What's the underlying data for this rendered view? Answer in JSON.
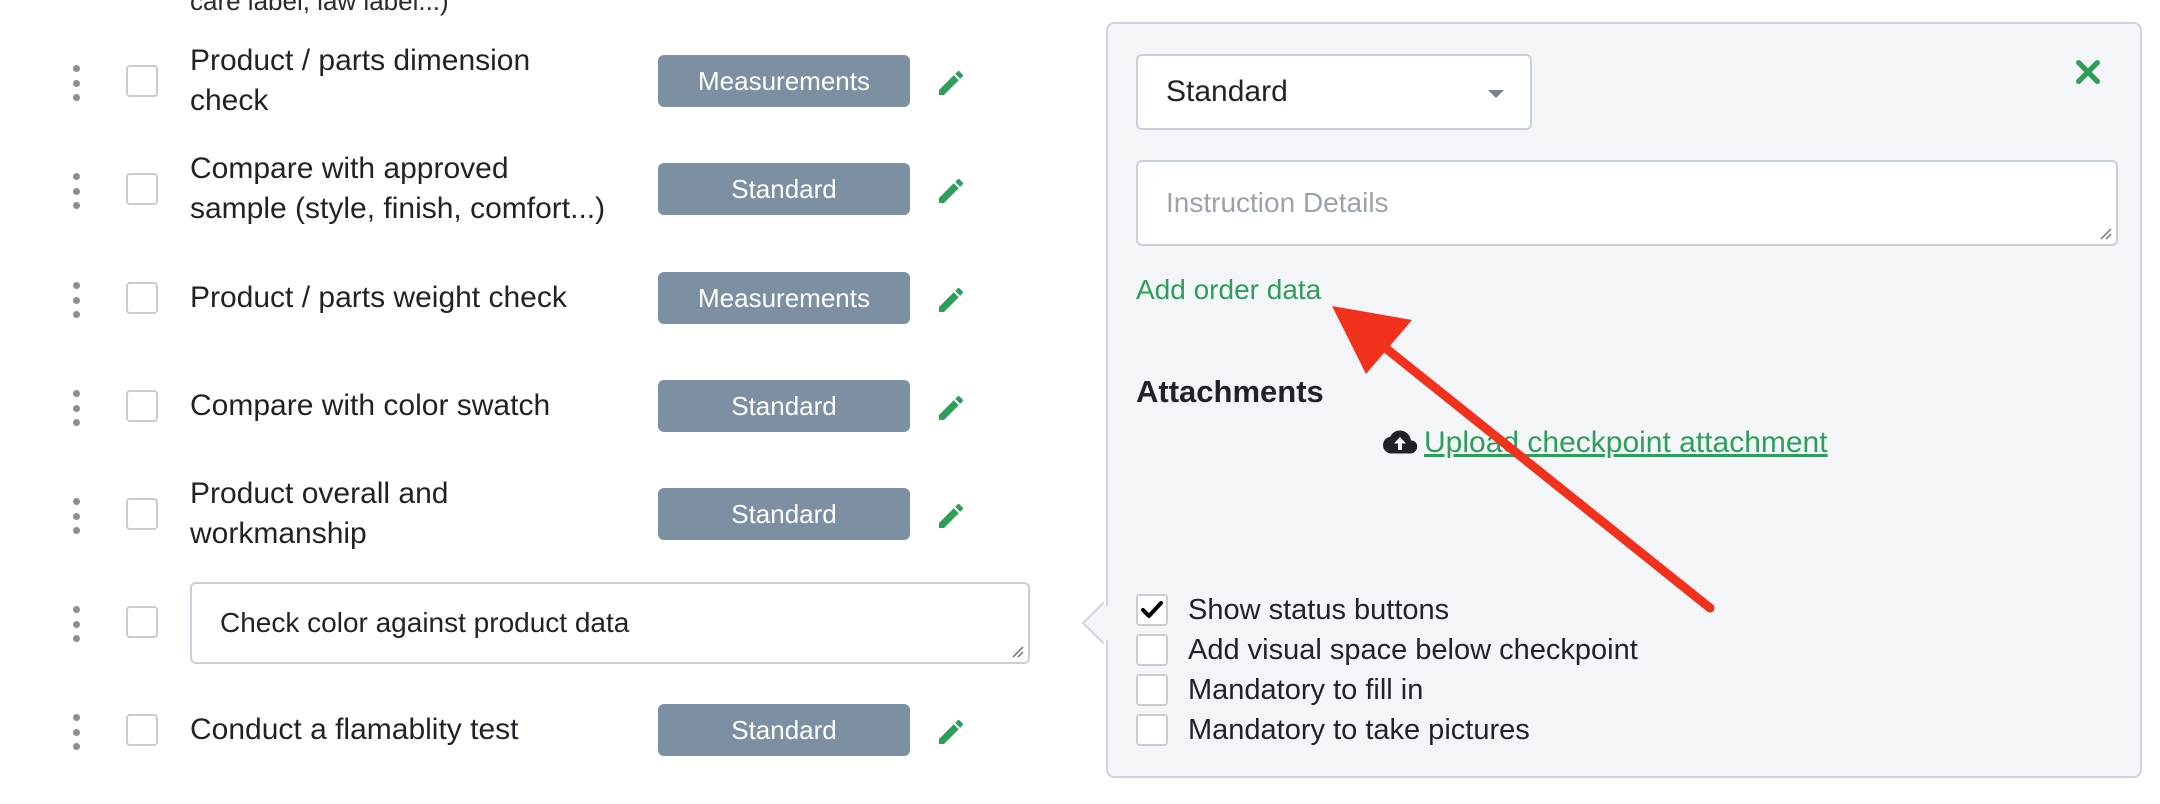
{
  "checklist": {
    "clipped_top_text": "care label, law label...)",
    "items": [
      {
        "label": "Product / parts dimension check",
        "badge": "Measurements"
      },
      {
        "label": "Compare with approved sample (style, finish, comfort...)",
        "badge": "Standard"
      },
      {
        "label": "Product / parts weight check",
        "badge": "Measurements"
      },
      {
        "label": "Compare with color swatch",
        "badge": "Standard"
      },
      {
        "label": "Product overall and workmanship",
        "badge": "Standard"
      }
    ],
    "editing_item": {
      "value": "Check color against product data"
    },
    "last_item": {
      "label": "Conduct a flamablity test",
      "badge": "Standard"
    }
  },
  "panel": {
    "type_select": {
      "value": "Standard"
    },
    "instruction": {
      "placeholder": "Instruction Details"
    },
    "add_order_link": "Add order data",
    "attachments_title": "Attachments",
    "upload_link": "Upload checkpoint attachment",
    "options": [
      {
        "label": "Show status buttons",
        "checked": true
      },
      {
        "label": "Add visual space below checkpoint",
        "checked": false
      },
      {
        "label": "Mandatory to fill in",
        "checked": false
      },
      {
        "label": "Mandatory to take pictures",
        "checked": false
      }
    ]
  },
  "colors": {
    "accent_green": "#2e9e5b",
    "badge_gray": "#7d8fa3",
    "annotation_red": "#f2311d"
  }
}
